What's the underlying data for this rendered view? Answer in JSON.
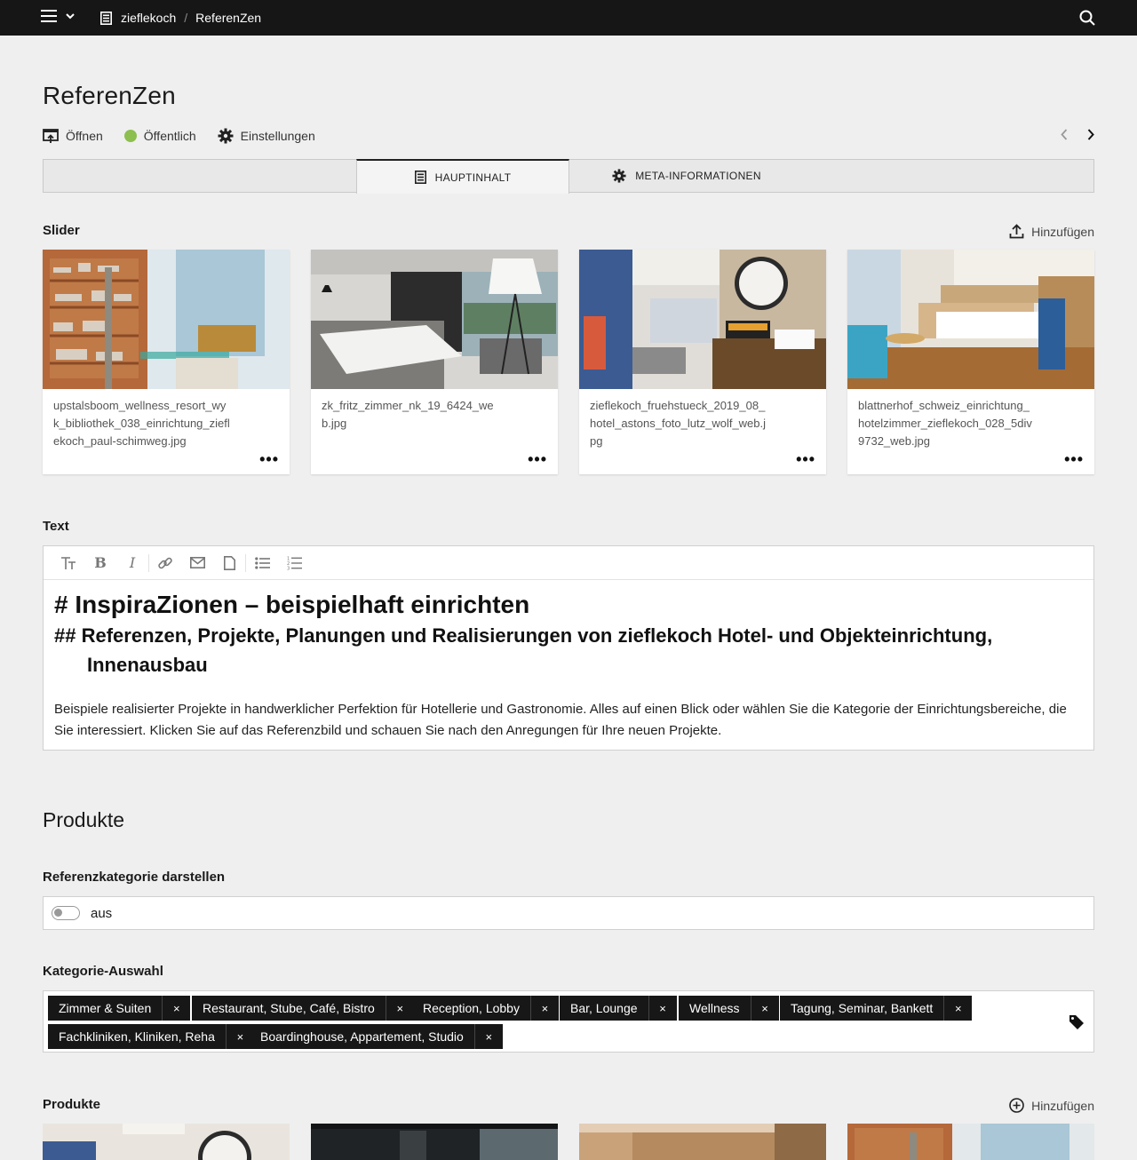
{
  "topbar": {
    "breadcrumb": [
      "zieflekoch",
      "ReferenZen"
    ],
    "sep": "/"
  },
  "page": {
    "title": "ReferenZen"
  },
  "actions": {
    "open": "Öffnen",
    "visibility": "Öffentlich",
    "settings": "Einstellungen",
    "visibility_color": "#8cbf4f"
  },
  "tabs": {
    "main": "HAUPTINHALT",
    "meta": "META-INFORMATIONEN"
  },
  "slider": {
    "label": "Slider",
    "add_label": "Hinzufügen",
    "images": [
      "upstalsboom_wellness_resort_wyk_bibliothek_038_einrichtung_zieflekoch_paul-schimweg.jpg",
      "zk_fritz_zimmer_nk_19_6424_web.jpg",
      "zieflekoch_fruehstueck_2019_08_hotel_astons_foto_lutz_wolf_web.jpg",
      "blattnerhof_schweiz_einrichtung_hotelzimmer_zieflekoch_028_5div9732_web.jpg"
    ],
    "more": "•••"
  },
  "text": {
    "label": "Text",
    "h1": "# InspiraZionen – beispielhaft einrichten",
    "h2": "## Referenzen, Projekte, Planungen und Realisierungen von zieflekoch Hotel- und Objekteinrichtung, Innenausbau",
    "paragraph": "Beispiele realisierter Projekte in handwerklicher Perfektion für Hotellerie und Gastronomie. Alles auf einen Blick oder wählen Sie die Kategorie der Einrichtungsbereiche, die Sie interessiert. Klicken Sie auf das Referenzbild und schauen Sie nach den Anregungen für Ihre neuen Projekte."
  },
  "products_section": {
    "heading": "Produkte",
    "toggle_label": "Referenzkategorie darstellen",
    "toggle_value": "aus",
    "categories_label": "Kategorie-Auswahl",
    "categories": [
      "Zimmer & Suiten",
      "Restaurant, Stube, Café, Bistro",
      "Reception, Lobby",
      "Bar, Lounge",
      "Wellness",
      "Tagung, Seminar, Bankett",
      "Fachkliniken, Kliniken, Reha",
      "Boardinghouse, Appartement, Studio"
    ],
    "remove": "×",
    "products_label": "Produkte",
    "products_add": "Hinzufügen"
  }
}
